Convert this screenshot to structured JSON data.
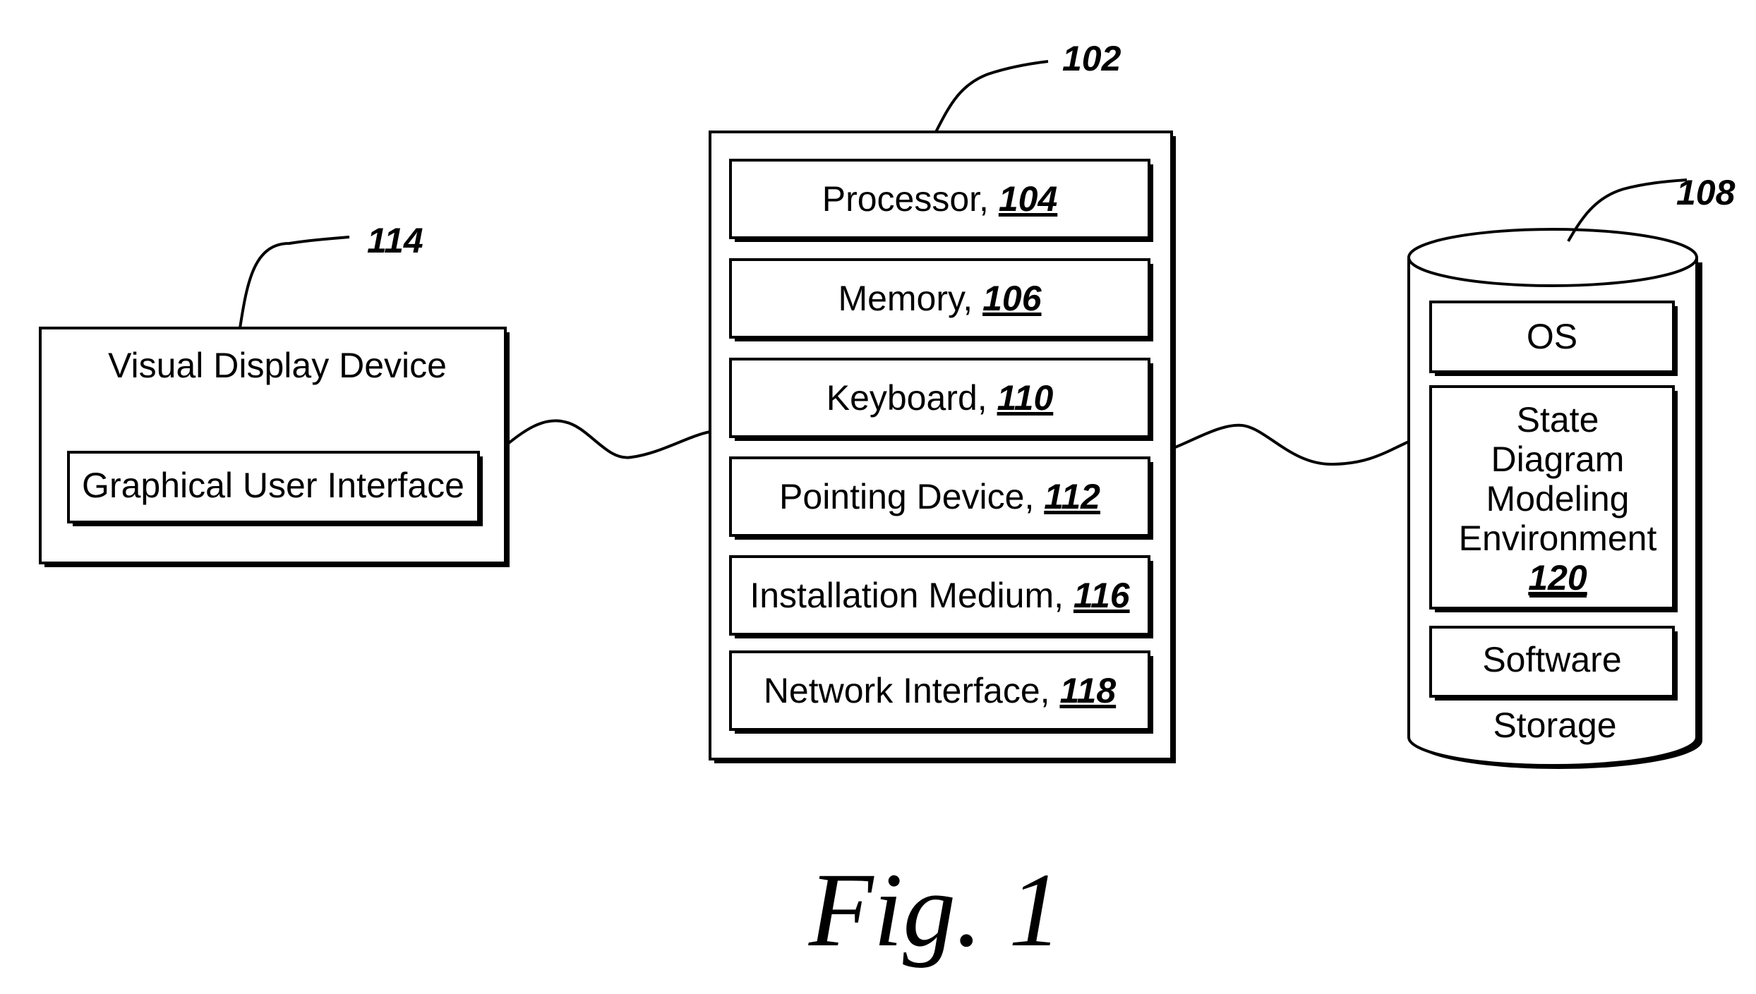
{
  "display_device": {
    "ref": "114",
    "title": "Visual Display Device",
    "gui_label": "Graphical User Interface"
  },
  "computing_device": {
    "ref": "102",
    "components": [
      {
        "label": "Processor, ",
        "ref": "104"
      },
      {
        "label": "Memory, ",
        "ref": "106"
      },
      {
        "label": "Keyboard, ",
        "ref": "110"
      },
      {
        "label": "Pointing Device, ",
        "ref": "112"
      },
      {
        "label": "Installation Medium, ",
        "ref": "116"
      },
      {
        "label": "Network Interface, ",
        "ref": "118"
      }
    ]
  },
  "storage": {
    "ref": "108",
    "label": "Storage",
    "os_label": "OS",
    "sdme_lines": [
      "State",
      "Diagram",
      "Modeling",
      "Environment"
    ],
    "sdme_ref": "120",
    "software_label": "Software"
  },
  "figure_caption": "Fig. 1"
}
